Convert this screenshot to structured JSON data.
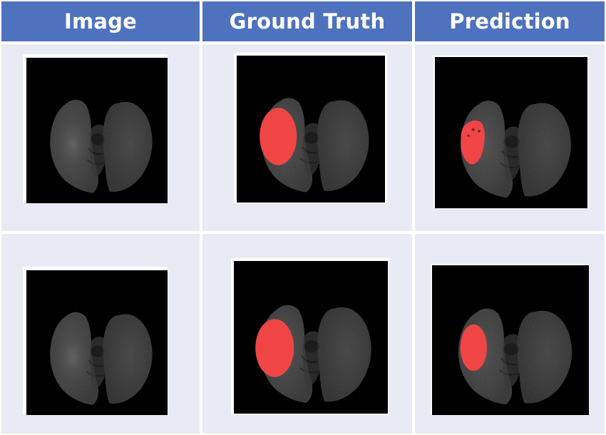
{
  "headers": {
    "image": "Image",
    "ground_truth": "Ground Truth",
    "prediction": "Prediction"
  },
  "colors": {
    "header_bg": "#4f72bf",
    "header_text": "#ffffff",
    "cell_bg": "#e8ebf3",
    "divider": "#ffffff",
    "mask": "#f04545",
    "scan_bg": "#000000"
  },
  "rows": [
    {
      "cells": [
        {
          "kind": "image",
          "has_mask": false
        },
        {
          "kind": "ground_truth",
          "has_mask": true
        },
        {
          "kind": "prediction",
          "has_mask": true
        }
      ]
    },
    {
      "cells": [
        {
          "kind": "image",
          "has_mask": false
        },
        {
          "kind": "ground_truth",
          "has_mask": true
        },
        {
          "kind": "prediction",
          "has_mask": true
        }
      ]
    }
  ]
}
